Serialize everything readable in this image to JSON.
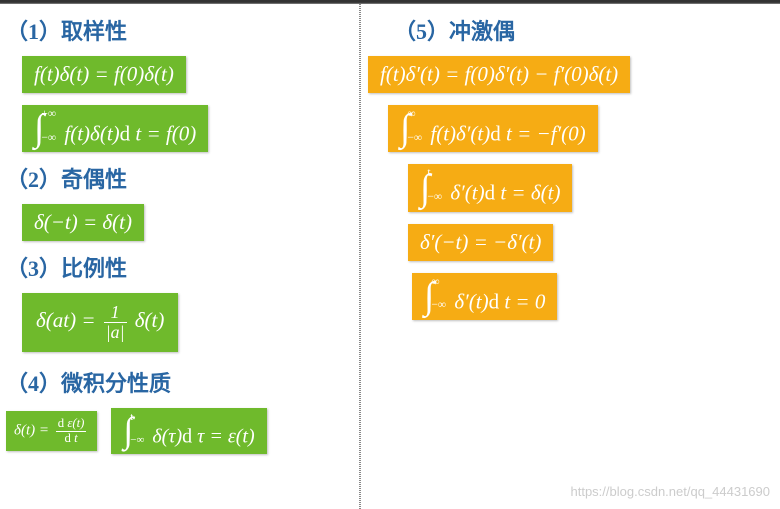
{
  "headings": {
    "h1": "（1）取样性",
    "h2": "（2）奇偶性",
    "h3": "（3）比例性",
    "h4": "（4）微积分性质",
    "h5": "（5）冲激偶"
  },
  "formulas": {
    "f1a": "f(t)δ(t) = f(0)δ(t)",
    "f1b_int_upper": "+∞",
    "f1b_int_lower": "−∞",
    "f1b_body": "f(t)δ(t) d t = f(0)",
    "f2": "δ(−t) = δ(t)",
    "f3_lhs": "δ(at) =",
    "f3_frac_top": "1",
    "f3_frac_bot": "|a|",
    "f3_rhs": " δ(t)",
    "f4a_lhs": "δ(t) =",
    "f4a_frac_top": "d ε(t)",
    "f4a_frac_bot": "d t",
    "f4b_int_upper": "t",
    "f4b_int_lower": "−∞",
    "f4b_body": " δ(τ) d τ = ε(t)",
    "f5a": "f(t)δ′(t) = f(0)δ′(t) − f′(0)δ(t)",
    "f5b_int_upper": "∞",
    "f5b_int_lower": "−∞",
    "f5b_body": "f(t)δ′(t) d t = −f′(0)",
    "f5c_int_upper": "t",
    "f5c_int_lower": "−∞",
    "f5c_body": " δ′(t) d t = δ(t)",
    "f5d": "δ′(−t) = −δ′(t)",
    "f5e_int_upper": "∞",
    "f5e_int_lower": "−∞",
    "f5e_body": " δ′(t) d t = 0"
  },
  "watermark": "https://blog.csdn.net/qq_44431690",
  "colors": {
    "heading": "#2966a3",
    "green": "#6fba2c",
    "orange": "#f6ac14"
  }
}
